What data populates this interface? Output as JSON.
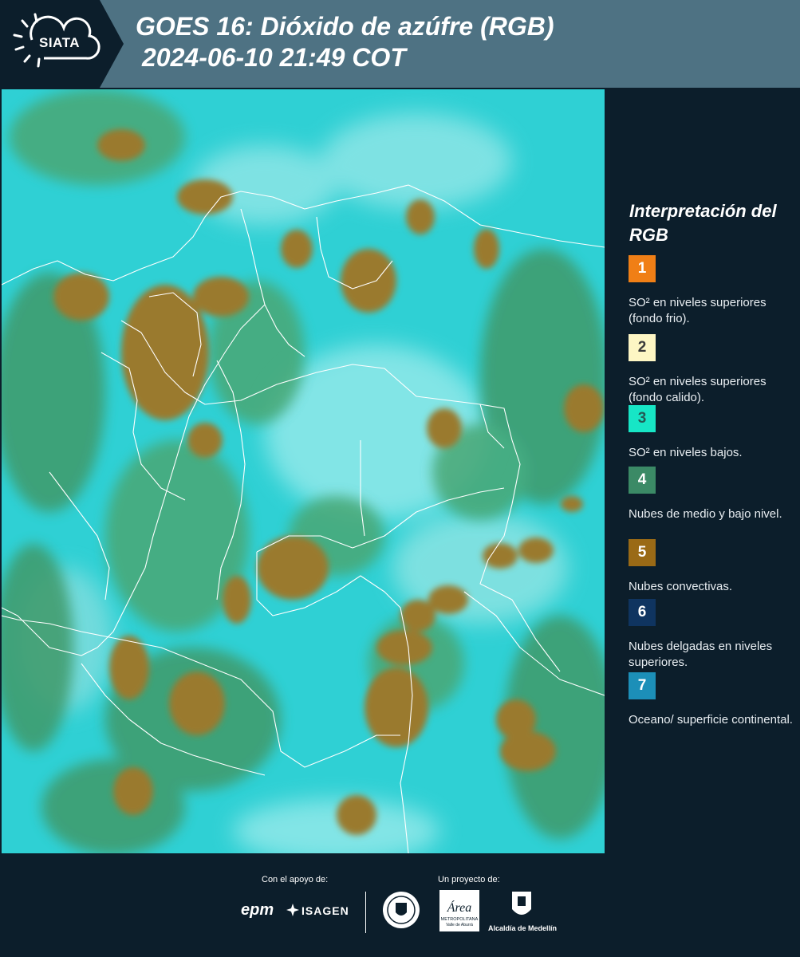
{
  "header": {
    "logo_text": "SIATA",
    "title_line1": "GOES 16: Dióxido de azúfre (RGB)",
    "title_line2": "2024-06-10 21:49 COT",
    "background_color": "#4e7283"
  },
  "legend": {
    "title": "Interpretación del RGB",
    "items": [
      {
        "number": "1",
        "color": "#f07f16",
        "text_color": "#ffffff",
        "label": "SO² en niveles superiores (fondo frio)."
      },
      {
        "number": "2",
        "color": "#fdf6c4",
        "text_color": "#3a3a3a",
        "label": "SO² en niveles superiores (fondo calido)."
      },
      {
        "number": "3",
        "color": "#17e6c6",
        "text_color": "#245a55",
        "label": "SO² en niveles bajos."
      },
      {
        "number": "4",
        "color": "#3b8a66",
        "text_color": "#ffffff",
        "label": "Nubes de medio y bajo nivel."
      },
      {
        "number": "5",
        "color": "#9a6a16",
        "text_color": "#ffffff",
        "label": "Nubes convectivas."
      },
      {
        "number": "6",
        "color": "#0f3460",
        "text_color": "#ffffff",
        "label": "Nubes delgadas en niveles superiores."
      },
      {
        "number": "7",
        "color": "#1c8fb8",
        "text_color": "#ffffff",
        "label": "Oceano/ superficie continental."
      }
    ]
  },
  "footer": {
    "support_label": "Con el apoyo de:",
    "project_label": "Un proyecto de:",
    "sponsor_epm": "epm",
    "sponsor_isagen": "ISAGEN",
    "partner_area_lines": [
      "Área",
      "METROPOLITANA",
      "Valle de Aburrá"
    ],
    "partner_alcaldia": "Alcaldía de Medellín"
  },
  "map": {
    "ocean_color": "#2fd0d4",
    "convective_color": "#9a7a2e",
    "midlevel_color": "#3f9a6a",
    "border_color": "#ffffff"
  }
}
